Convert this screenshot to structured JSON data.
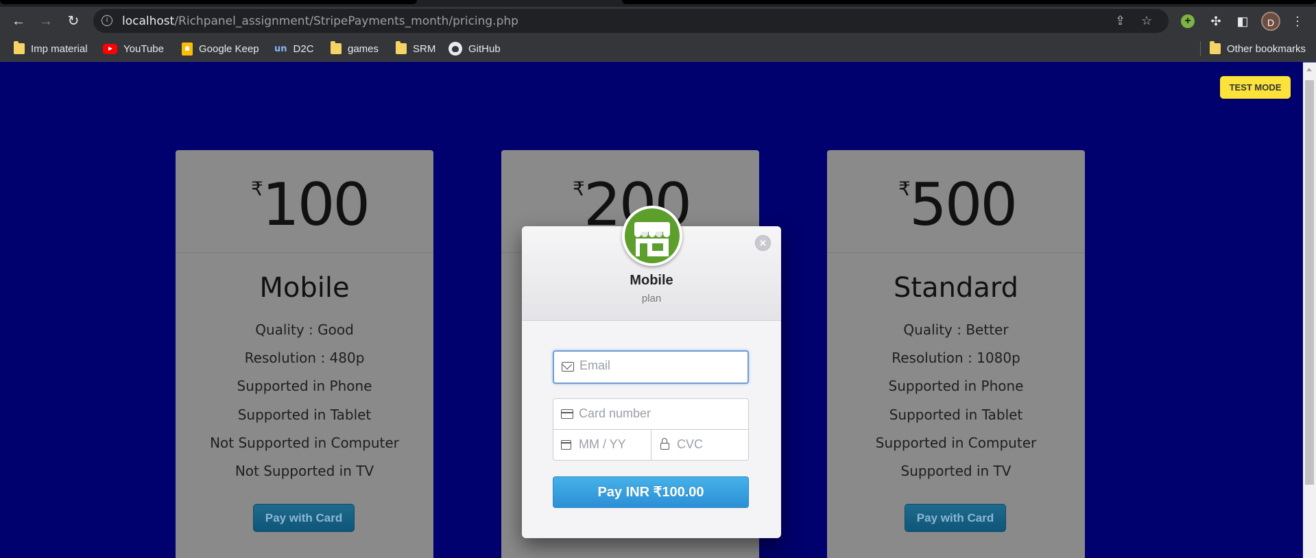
{
  "browser": {
    "url_host": "localhost",
    "url_path": "/Richpanel_assignment/StripePayments_month/pricing.php",
    "profile_initial": "D",
    "bookmarks": [
      "Imp material",
      "YouTube",
      "Google Keep",
      "D2C",
      "games",
      "SRM",
      "GitHub"
    ],
    "other_bookmarks": "Other bookmarks",
    "un_badge": "un"
  },
  "page": {
    "test_mode": "TEST MODE",
    "currency_symbol": "₹",
    "plans": [
      {
        "price": "100",
        "name": "Mobile",
        "features": [
          "Quality : Good",
          "Resolution : 480p",
          "Supported in Phone",
          "Supported in Tablet",
          "Not Supported in Computer",
          "Not Supported in TV"
        ],
        "button": "Pay with Card"
      },
      {
        "price": "200"
      },
      {
        "price": "500",
        "name": "Standard",
        "features": [
          "Quality : Better",
          "Resolution : 1080p",
          "Supported in Phone",
          "Supported in Tablet",
          "Supported in Computer",
          "Supported in TV"
        ],
        "button": "Pay with Card"
      }
    ]
  },
  "modal": {
    "title": "Mobile",
    "subtitle": "plan",
    "close": "×",
    "email_placeholder": "Email",
    "card_placeholder": "Card number",
    "expiry_placeholder": "MM / YY",
    "cvc_placeholder": "CVC",
    "pay_button": "Pay INR ₹100.00"
  }
}
